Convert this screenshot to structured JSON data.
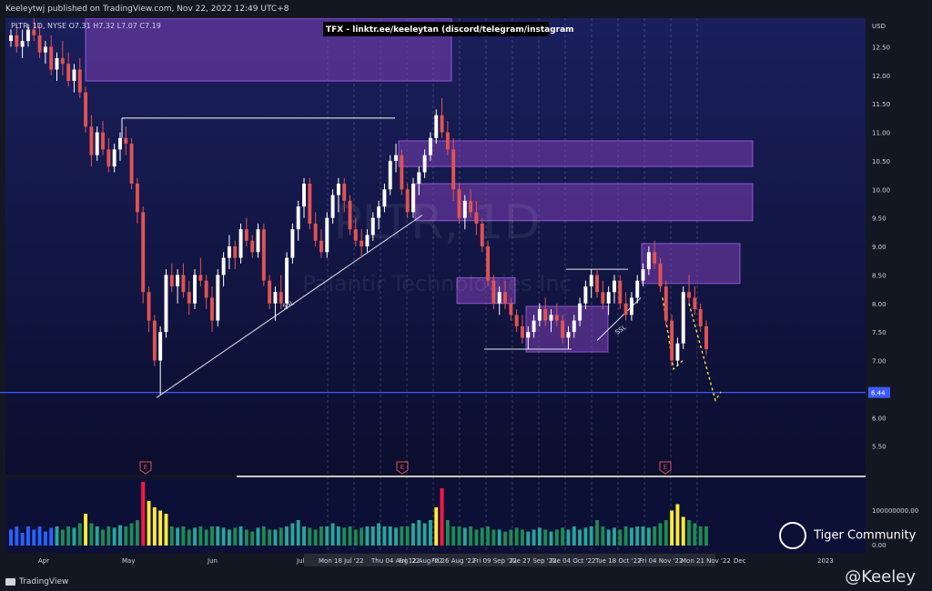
{
  "header": {
    "published": "Keeleytwj published on TradingView.com, Nov 22, 2022 12:49 UTC+8",
    "legend": "PLTR, 1D, NYSE O7.31 H7.32 L7.07 C7.19",
    "banner": "TFX - linktr.ee/keeleytan (discord/telegram/instagram"
  },
  "watermark": {
    "symbol": "PLTR, 1D",
    "name": "Palantir Technologies Inc"
  },
  "footer": {
    "brand": "TradingView",
    "handle": "@Keeley",
    "community": "Tiger Community"
  },
  "colors": {
    "up": "#ffffff",
    "down": "#e05353",
    "zone": "#7b3fb5",
    "volUp": "#26a69a",
    "volDown": "#2962ff",
    "volHigh": "#ffeb3b",
    "volMax": "#ff1744",
    "support": "#3d5afe"
  },
  "chart_data": {
    "type": "candlestick",
    "currency": "USD",
    "price_axis": {
      "ticks": [
        "12.50",
        "12.00",
        "11.50",
        "11.00",
        "10.50",
        "10.00",
        "9.50",
        "9.00",
        "8.50",
        "8.00",
        "7.50",
        "7.00",
        "6.50",
        "6.00",
        "5.50"
      ],
      "ylim": [
        5.0,
        13.0
      ]
    },
    "last_price_label": "6.44",
    "volume_axis": {
      "ticks": [
        "100000000.00",
        "0.00"
      ]
    },
    "time_axis": {
      "ticks": [
        "Apr",
        "May",
        "Jun",
        "Jul",
        "Mon 18 Jul '22",
        "Thu 04 Aug '22",
        "Fri 12 Aug '22",
        "Fri 26 Aug '22",
        "Fri 09 Sep '22",
        "Tue 27 Sep '22",
        "Tue 04 Oct '22",
        "Tue 18 Oct '22",
        "Fri 04 Nov '22",
        "Mon 21 Nov '22",
        "Dec",
        "2023"
      ]
    },
    "annotations": [
      "SSL",
      "SSL",
      "E",
      "E",
      "E"
    ],
    "candles": [
      [
        12.6,
        12.8,
        12.5,
        12.7
      ],
      [
        12.7,
        12.9,
        12.4,
        12.5
      ],
      [
        12.5,
        12.8,
        12.3,
        12.6
      ],
      [
        12.6,
        12.9,
        12.5,
        12.8
      ],
      [
        12.8,
        13.0,
        12.6,
        12.7
      ],
      [
        12.7,
        12.9,
        12.3,
        12.4
      ],
      [
        12.4,
        12.6,
        12.2,
        12.5
      ],
      [
        12.5,
        12.7,
        12.0,
        12.1
      ],
      [
        12.1,
        12.4,
        11.9,
        12.3
      ],
      [
        12.3,
        12.6,
        12.0,
        12.2
      ],
      [
        12.2,
        12.4,
        11.8,
        11.9
      ],
      [
        11.9,
        12.2,
        11.7,
        12.1
      ],
      [
        12.1,
        12.3,
        11.6,
        11.7
      ],
      [
        11.7,
        11.8,
        11.0,
        11.1
      ],
      [
        11.1,
        11.3,
        10.4,
        10.6
      ],
      [
        10.6,
        11.1,
        10.5,
        11.0
      ],
      [
        11.0,
        11.2,
        10.6,
        10.7
      ],
      [
        10.7,
        10.9,
        10.3,
        10.4
      ],
      [
        10.4,
        10.8,
        10.3,
        10.7
      ],
      [
        10.7,
        11.0,
        10.5,
        10.9
      ],
      [
        10.9,
        11.1,
        10.6,
        10.8
      ],
      [
        10.8,
        10.9,
        10.0,
        10.1
      ],
      [
        10.1,
        10.2,
        9.4,
        9.6
      ],
      [
        9.6,
        9.7,
        8.0,
        8.2
      ],
      [
        8.2,
        8.3,
        7.5,
        7.7
      ],
      [
        7.7,
        7.8,
        6.9,
        7.0
      ],
      [
        7.0,
        7.6,
        6.4,
        7.5
      ],
      [
        7.5,
        8.6,
        7.4,
        8.5
      ],
      [
        8.5,
        8.7,
        8.2,
        8.3
      ],
      [
        8.3,
        8.6,
        8.0,
        8.5
      ],
      [
        8.5,
        8.7,
        8.1,
        8.2
      ],
      [
        8.2,
        8.4,
        7.8,
        8.0
      ],
      [
        8.0,
        8.6,
        7.9,
        8.5
      ],
      [
        8.5,
        8.8,
        8.3,
        8.4
      ],
      [
        8.4,
        8.5,
        7.9,
        8.1
      ],
      [
        8.1,
        8.3,
        7.5,
        7.7
      ],
      [
        7.7,
        8.6,
        7.6,
        8.5
      ],
      [
        8.5,
        8.9,
        8.3,
        8.8
      ],
      [
        8.8,
        9.2,
        8.6,
        9.0
      ],
      [
        9.0,
        9.1,
        8.6,
        8.8
      ],
      [
        8.8,
        9.4,
        8.7,
        9.3
      ],
      [
        9.3,
        9.5,
        9.0,
        9.1
      ],
      [
        9.1,
        9.2,
        8.8,
        8.9
      ],
      [
        8.9,
        9.4,
        8.8,
        9.3
      ],
      [
        9.3,
        9.4,
        8.3,
        8.4
      ],
      [
        8.4,
        8.5,
        7.9,
        8.0
      ],
      [
        8.0,
        8.3,
        7.7,
        8.2
      ],
      [
        8.2,
        8.5,
        7.9,
        8.0
      ],
      [
        8.0,
        8.9,
        7.9,
        8.8
      ],
      [
        8.8,
        9.4,
        8.7,
        9.3
      ],
      [
        9.3,
        9.8,
        9.1,
        9.7
      ],
      [
        9.7,
        10.2,
        9.5,
        10.1
      ],
      [
        10.1,
        10.2,
        9.3,
        9.4
      ],
      [
        9.4,
        9.6,
        9.0,
        9.1
      ],
      [
        9.1,
        9.3,
        8.8,
        8.9
      ],
      [
        8.9,
        9.6,
        8.8,
        9.5
      ],
      [
        9.5,
        10.0,
        9.4,
        9.9
      ],
      [
        9.9,
        10.2,
        9.6,
        10.1
      ],
      [
        10.1,
        10.2,
        9.6,
        9.8
      ],
      [
        9.8,
        9.9,
        9.2,
        9.3
      ],
      [
        9.3,
        9.5,
        9.0,
        9.1
      ],
      [
        9.1,
        9.3,
        8.8,
        9.0
      ],
      [
        9.0,
        9.3,
        8.9,
        9.2
      ],
      [
        9.2,
        9.6,
        9.1,
        9.5
      ],
      [
        9.5,
        9.8,
        9.3,
        9.7
      ],
      [
        9.7,
        10.1,
        9.6,
        10.0
      ],
      [
        10.0,
        10.6,
        9.9,
        10.5
      ],
      [
        10.5,
        10.8,
        10.3,
        10.6
      ],
      [
        10.6,
        10.7,
        9.9,
        10.0
      ],
      [
        10.0,
        10.1,
        9.5,
        9.6
      ],
      [
        9.6,
        10.2,
        9.5,
        10.1
      ],
      [
        10.1,
        10.4,
        9.9,
        10.3
      ],
      [
        10.3,
        10.7,
        10.2,
        10.6
      ],
      [
        10.6,
        11.0,
        10.5,
        10.9
      ],
      [
        10.9,
        11.4,
        10.8,
        11.3
      ],
      [
        11.3,
        11.6,
        10.9,
        11.0
      ],
      [
        11.0,
        11.2,
        10.6,
        10.7
      ],
      [
        10.7,
        10.9,
        9.8,
        10.0
      ],
      [
        10.0,
        10.1,
        9.4,
        9.5
      ],
      [
        9.5,
        9.9,
        9.3,
        9.8
      ],
      [
        9.8,
        10.0,
        9.5,
        9.6
      ],
      [
        9.6,
        9.8,
        9.2,
        9.4
      ],
      [
        9.4,
        9.5,
        8.9,
        9.0
      ],
      [
        9.0,
        9.1,
        8.3,
        8.4
      ],
      [
        8.4,
        8.5,
        7.9,
        8.0
      ],
      [
        8.0,
        8.3,
        7.8,
        8.2
      ],
      [
        8.2,
        8.4,
        7.9,
        8.0
      ],
      [
        8.0,
        8.1,
        7.7,
        7.8
      ],
      [
        7.8,
        7.9,
        7.5,
        7.6
      ],
      [
        7.6,
        7.8,
        7.3,
        7.4
      ],
      [
        7.4,
        7.6,
        7.2,
        7.5
      ],
      [
        7.5,
        7.8,
        7.4,
        7.7
      ],
      [
        7.7,
        8.0,
        7.6,
        7.9
      ],
      [
        7.9,
        8.1,
        7.6,
        7.7
      ],
      [
        7.7,
        7.9,
        7.5,
        7.8
      ],
      [
        7.8,
        8.0,
        7.6,
        7.7
      ],
      [
        7.7,
        7.8,
        7.3,
        7.4
      ],
      [
        7.4,
        7.6,
        7.2,
        7.5
      ],
      [
        7.5,
        7.8,
        7.4,
        7.7
      ],
      [
        7.7,
        8.1,
        7.6,
        8.0
      ],
      [
        8.0,
        8.4,
        7.9,
        8.3
      ],
      [
        8.3,
        8.6,
        8.1,
        8.5
      ],
      [
        8.5,
        8.6,
        8.1,
        8.2
      ],
      [
        8.2,
        8.4,
        7.9,
        8.0
      ],
      [
        8.0,
        8.3,
        7.8,
        8.2
      ],
      [
        8.2,
        8.5,
        8.0,
        8.4
      ],
      [
        8.4,
        8.5,
        7.9,
        8.0
      ],
      [
        8.0,
        8.2,
        7.7,
        7.8
      ],
      [
        7.8,
        8.2,
        7.7,
        8.1
      ],
      [
        8.1,
        8.5,
        8.0,
        8.4
      ],
      [
        8.4,
        8.7,
        8.3,
        8.6
      ],
      [
        8.6,
        9.0,
        8.5,
        8.9
      ],
      [
        8.9,
        9.1,
        8.6,
        8.7
      ],
      [
        8.7,
        8.8,
        8.2,
        8.3
      ],
      [
        8.3,
        8.4,
        7.6,
        7.7
      ],
      [
        7.7,
        7.8,
        6.9,
        7.0
      ],
      [
        7.0,
        7.4,
        6.9,
        7.3
      ],
      [
        7.3,
        8.3,
        7.2,
        8.2
      ],
      [
        8.2,
        8.5,
        8.0,
        8.1
      ],
      [
        8.1,
        8.3,
        7.8,
        7.9
      ],
      [
        7.9,
        8.0,
        7.5,
        7.6
      ],
      [
        7.6,
        7.7,
        7.1,
        7.2
      ]
    ],
    "volumes": [
      0.25,
      0.3,
      0.2,
      0.3,
      0.25,
      0.3,
      0.22,
      0.28,
      0.3,
      0.25,
      0.3,
      0.28,
      0.35,
      0.5,
      0.35,
      0.3,
      0.25,
      0.3,
      0.28,
      0.32,
      0.3,
      0.35,
      0.4,
      1.0,
      0.7,
      0.6,
      0.55,
      0.5,
      0.3,
      0.28,
      0.3,
      0.25,
      0.28,
      0.3,
      0.25,
      0.3,
      0.3,
      0.28,
      0.25,
      0.28,
      0.3,
      0.25,
      0.22,
      0.28,
      0.3,
      0.25,
      0.25,
      0.28,
      0.3,
      0.35,
      0.4,
      0.3,
      0.28,
      0.25,
      0.3,
      0.3,
      0.35,
      0.3,
      0.28,
      0.3,
      0.25,
      0.28,
      0.3,
      0.3,
      0.35,
      0.3,
      0.3,
      0.28,
      0.3,
      0.3,
      0.35,
      0.4,
      0.35,
      0.4,
      0.6,
      0.9,
      0.4,
      0.3,
      0.3,
      0.28,
      0.3,
      0.25,
      0.28,
      0.3,
      0.25,
      0.25,
      0.22,
      0.25,
      0.28,
      0.25,
      0.22,
      0.25,
      0.28,
      0.25,
      0.22,
      0.25,
      0.28,
      0.25,
      0.3,
      0.25,
      0.28,
      0.3,
      0.4,
      0.3,
      0.25,
      0.28,
      0.25,
      0.3,
      0.28,
      0.3,
      0.3,
      0.28,
      0.3,
      0.35,
      0.4,
      0.55,
      0.65,
      0.45,
      0.4,
      0.35,
      0.3,
      0.3
    ],
    "zones": [
      [
        11.9,
        13.0
      ],
      [
        10.4,
        10.85
      ],
      [
        9.45,
        10.1
      ],
      [
        8.35,
        9.05
      ],
      [
        8.0,
        8.45
      ],
      [
        7.15,
        7.95
      ]
    ],
    "support_level": 6.44
  }
}
